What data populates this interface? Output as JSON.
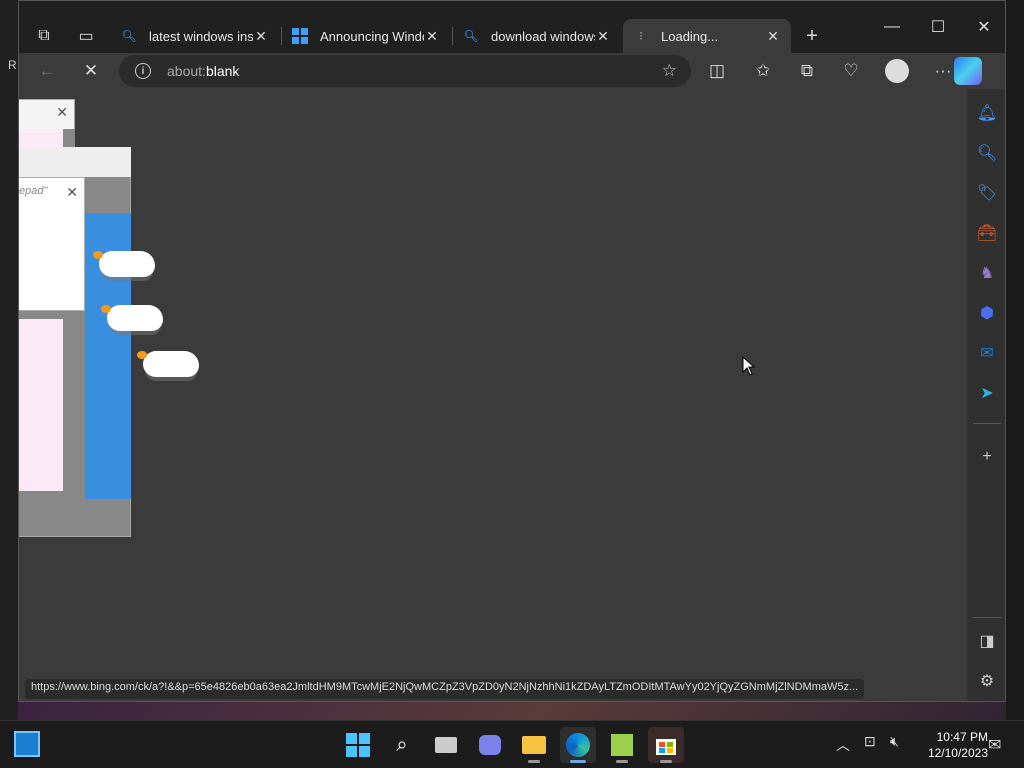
{
  "browser": {
    "tabs": [
      {
        "title": "latest windows insid",
        "icon": "search-icon"
      },
      {
        "title": "Announcing Windo",
        "icon": "windows-logo-icon"
      },
      {
        "title": "download windows",
        "icon": "search-icon"
      },
      {
        "title": "Loading...",
        "icon": "loading-icon",
        "active": true
      }
    ],
    "address": {
      "scheme": "about:",
      "path": "blank"
    },
    "status_url": "https://www.bing.com/ck/a?!&&p=65e4826eb0a63ea2JmltdHM9MTcwMjE2NjQwMCZpZ3VpZD0yN2NjNzhhNi1kZDAyLTZmODItMTAwYy02YjQyZGNmMjZlNDMmaW5z..."
  },
  "background": {
    "fragment_text": "R",
    "notepad_title": "epad\""
  },
  "taskbar": {
    "time": "10:47 PM",
    "date": "12/10/2023"
  },
  "colors": {
    "accent": "#2b7cf0",
    "content_bg": "#3b3b3b",
    "tabbar_bg": "#202020"
  }
}
